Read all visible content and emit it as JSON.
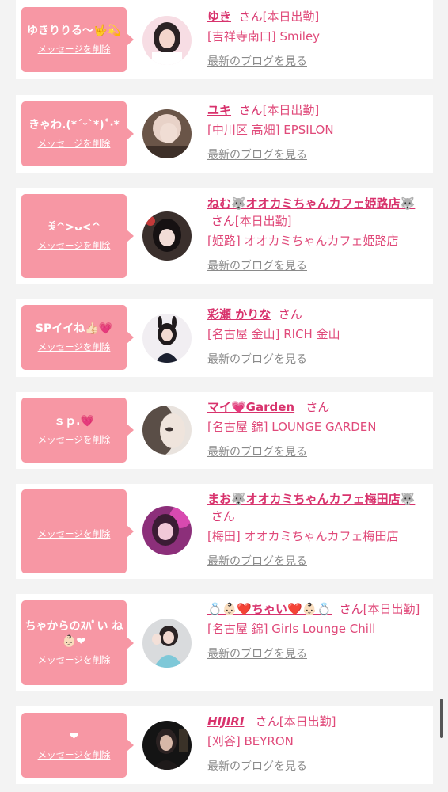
{
  "delete_label": "メッセージを削除",
  "blog_label": "最新のブログを見る",
  "colors": {
    "bubble": "#f797a4",
    "name": "#d8336d",
    "text": "#e04a7a",
    "link": "#8a8a8a"
  },
  "items": [
    {
      "message": "ゆきりりる〜🤟💫",
      "name": "ゆき",
      "honorific": "さん",
      "status": "[本日出勤]",
      "shop": "[吉祥寺南口] Smiley"
    },
    {
      "message": "きゃわ.(*´ᵕ`*)˚‧*",
      "name": "ユキ",
      "honorific": "さん",
      "status": "[本日出勤]",
      "shop": "[中川区 高畑] EPSILON"
    },
    {
      "message": "ꉂ^>ᴗ<^",
      "name": "ねむ🐺オオカミちゃんカフェ姫路店🐺",
      "honorific": "さん",
      "status": "[本日出勤]",
      "shop": "[姫路] オオカミちゃんカフェ姫路店"
    },
    {
      "message": "SPイイね👍🏻💗",
      "name": "彩瀬 かりな",
      "honorific": "さん",
      "status": "",
      "shop": "[名古屋 金山] RICH 金山"
    },
    {
      "message": "ｓｐ.💗",
      "name": "マイ💗Garden",
      "honorific": "さん",
      "status": "",
      "shop": "[名古屋 錦] LOUNGE GARDEN"
    },
    {
      "message": "",
      "name": "まお🐺オオカミちゃんカフェ梅田店🐺",
      "honorific": "さん",
      "status": "",
      "shop": "[梅田] オオカミちゃんカフェ梅田店"
    },
    {
      "message": "ちゃからのｽﾊﾟい ね👶🏻❤",
      "name": "💍👶🏻❤️ちゃい❤️👶🏻💍",
      "honorific": "さん",
      "status": "[本日出勤]",
      "shop": "[名古屋 錦] Girls Lounge Chill"
    },
    {
      "message": "❤",
      "name": "HIJIRI",
      "honorific": "さん",
      "status": "[本日出勤]",
      "shop": "[刈谷] BEYRON"
    }
  ]
}
